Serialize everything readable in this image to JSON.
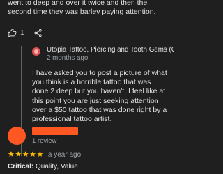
{
  "previous_review": {
    "text": "went to deep and over it twice and then the second time they was barley paying attention.",
    "like_count": "1"
  },
  "owner_reply": {
    "name": "Utopia Tattoo, Piercing and Tooth Gems (Owner)",
    "time": "2 months ago",
    "text": "I have asked you to post a picture of what you think is a horrible tattoo that was done 2 deep but you haven't. I feel like at this point you are just seeking attention over a $50 tattoo that was done right by a professional tattoo artist."
  },
  "next_review": {
    "review_count": "1 review",
    "rating": 5,
    "time": "a year ago",
    "critical_label": "Critical:",
    "critical_values": "Quality, Value"
  },
  "colors": {
    "background": "#1f1f1f",
    "star": "#fbbc04",
    "reviewer_avatar": "#ff5722",
    "owner_avatar": "#e05050"
  }
}
